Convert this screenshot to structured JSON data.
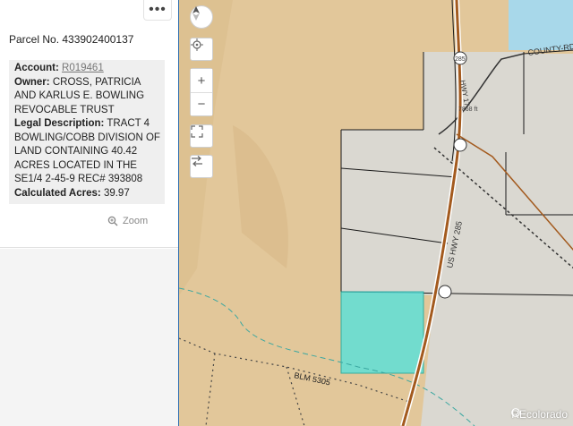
{
  "panel": {
    "more_label": "•••",
    "parcel_title": "Parcel No. 433902400137",
    "account_label": "Account:",
    "account_value": "R019461",
    "owner_label": "Owner:",
    "owner_value": "CROSS, PATRICIA AND KARLUS E. BOWLING REVOCABLE TRUST",
    "legal_label": "Legal Description:",
    "legal_value": "TRACT 4 BOWLING/COBB DIVISION OF LAND CONTAINING 40.42 ACRES LOCATED IN THE SE1/4 2-45-9 REC# 393808",
    "acres_label": "Calculated Acres:",
    "acres_value": "39.97",
    "zoom_label": "Zoom"
  },
  "map": {
    "controls": [
      "compass-icon",
      "locate-icon",
      "zoom-in-icon",
      "zoom-out-icon",
      "fullscreen-icon",
      "swap-icon"
    ],
    "zoom_in_label": "+",
    "zoom_out_label": "−",
    "labels": {
      "county_rd": "COUNTY-RD",
      "us_hwy": "US HWY 285",
      "hwy_285_shield": "285",
      "blm": "BLM 5305",
      "elevation": "7868 ft",
      "hwy_vert": "HWY 17"
    },
    "colors": {
      "terrain": "#e2c79a",
      "parcel_fill": "#d9d9d9",
      "selected_parcel": "#5fe0d8",
      "water": "#a8d8ea",
      "highway": "#a35a1e"
    }
  },
  "watermark": "REcolorado"
}
